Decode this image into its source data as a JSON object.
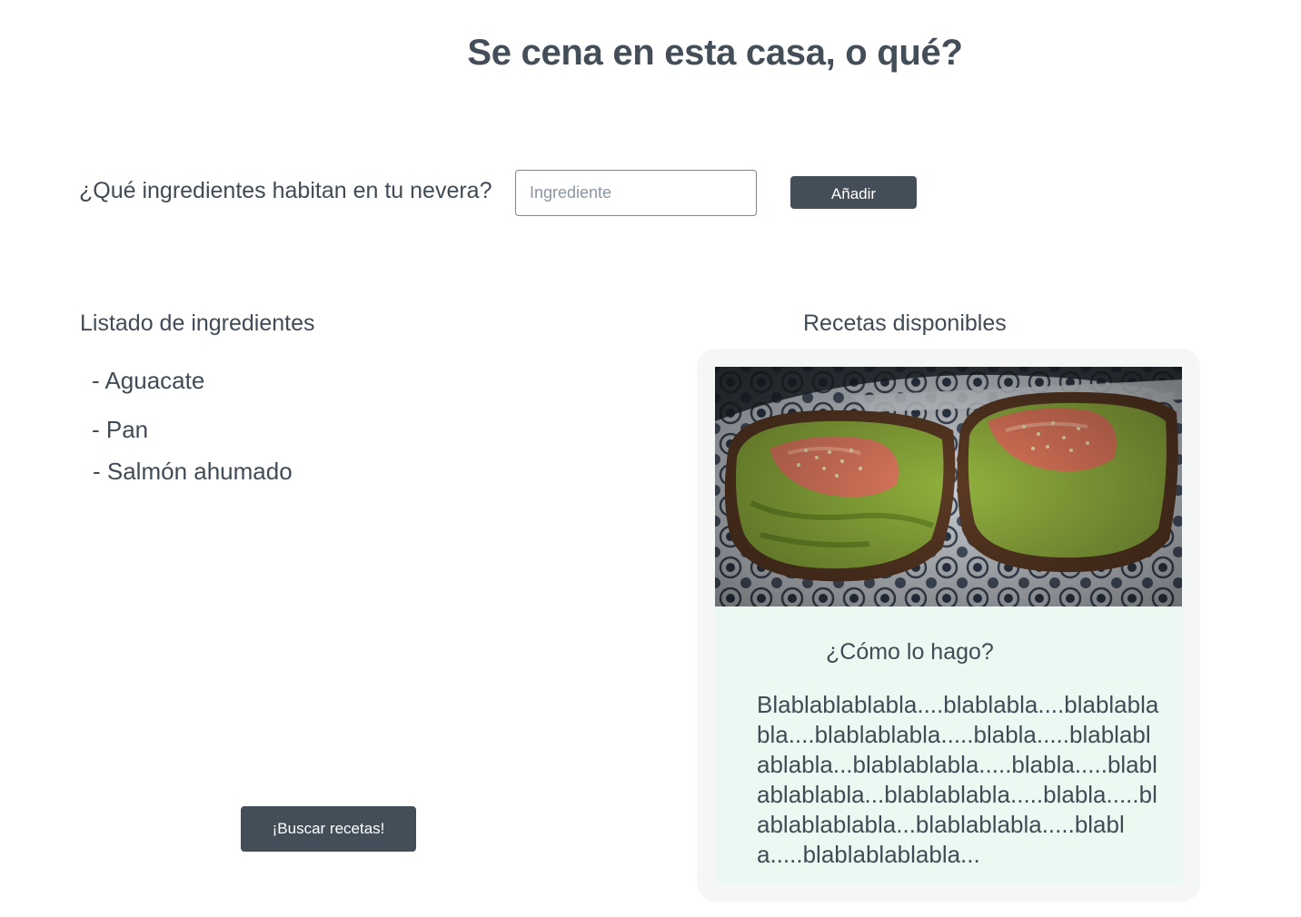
{
  "header": {
    "title": "Se cena en esta casa, o qué?"
  },
  "add_form": {
    "question": "¿Qué ingredientes habitan en tu nevera?",
    "input_placeholder": "Ingrediente",
    "input_value": "",
    "add_button_label": "Añadir"
  },
  "ingredients": {
    "heading": "Listado de ingredientes",
    "items": [
      "- Aguacate",
      "- Pan",
      "- Salmón ahumado"
    ],
    "search_button_label": "¡Buscar recetas!"
  },
  "recipes": {
    "heading": "Recetas disponibles",
    "card": {
      "image_subject": "avocado-salmon-toast",
      "how_to_label": "¿Cómo lo hago?",
      "instructions": "Blablablablabla....blablabla....blablablabla....blablablabla.....blabla.....blablablablabla...blablablabla.....blabla.....blablablablabla...blablablabla.....blabla.....blablablablabla...blablablabla.....blabla.....blablablablabla..."
    }
  },
  "colors": {
    "text": "#414b55",
    "button_bg": "#444e59",
    "button_text": "#ffffff",
    "card_outer": "#f5f7f6",
    "card_inner": "#ecf9f2"
  }
}
